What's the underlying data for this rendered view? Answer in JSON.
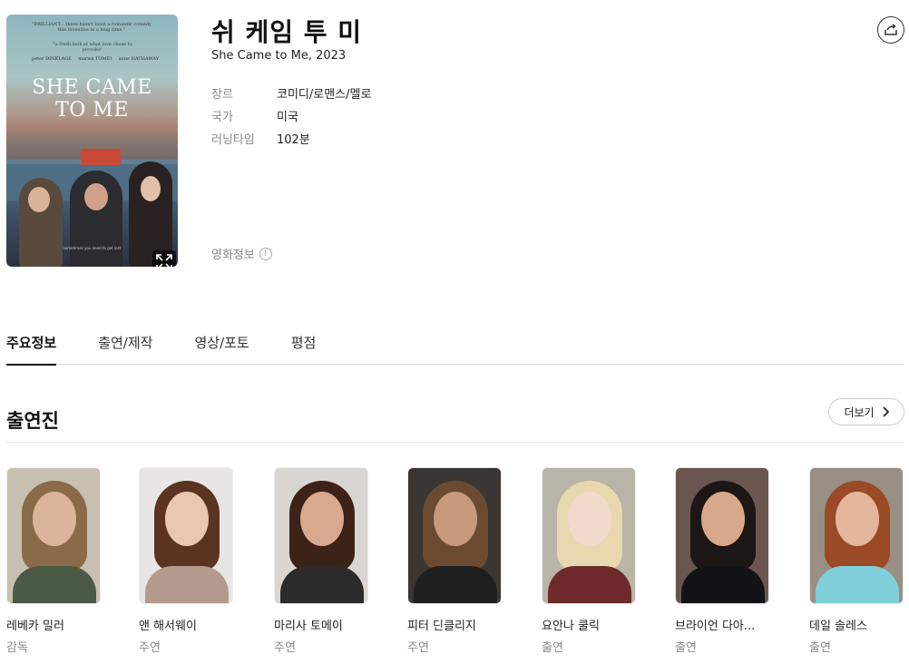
{
  "movie": {
    "title": "쉬 케임 투 미",
    "subtitle": "She Came to Me, 2023",
    "meta": [
      {
        "key": "장르",
        "value": "코미디/로맨스/멜로"
      },
      {
        "key": "국가",
        "value": "미국"
      },
      {
        "key": "러닝타임",
        "value": "102분"
      }
    ],
    "info_label": "영화정보",
    "info_icon": "!",
    "poster": {
      "quote": "\"BRILLIANT... there hasn't been a romantic comedy this inventive in a long time.\"",
      "quote2": "\"a fresh look at what love chose to provoke\"",
      "actors": [
        "peter DINKLAGE",
        "marisa TOMEI",
        "anne HATHAWAY"
      ],
      "title_line1": "SHE CAME",
      "title_line2": "TO ME",
      "tagline": "sometimes you need to get lost"
    }
  },
  "tabs": [
    {
      "label": "주요정보",
      "active": true
    },
    {
      "label": "출연/제작",
      "active": false
    },
    {
      "label": "영상/포토",
      "active": false
    },
    {
      "label": "평점",
      "active": false
    }
  ],
  "cast_section": {
    "title": "출연진",
    "more_label": "더보기"
  },
  "cast": [
    {
      "name": "레베카 밀러",
      "role": "감독"
    },
    {
      "name": "앤 해서웨이",
      "role": "주연"
    },
    {
      "name": "마리사 토메이",
      "role": "주연"
    },
    {
      "name": "피터 딘클리지",
      "role": "주연"
    },
    {
      "name": "요안나 쿨릭",
      "role": "출연"
    },
    {
      "name": "브라이언 다아...",
      "role": "출연"
    },
    {
      "name": "데일 솔레스",
      "role": "출연"
    }
  ],
  "colors": {
    "text_primary": "#111111",
    "text_secondary": "#888888",
    "divider": "#dddddd"
  }
}
